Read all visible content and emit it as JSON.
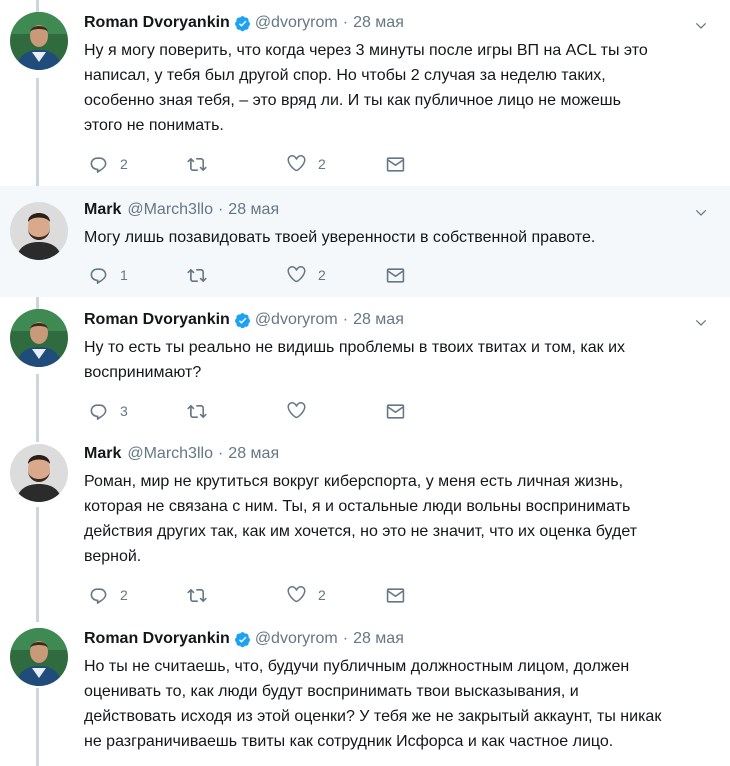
{
  "tweets": [
    {
      "author": "Roman Dvoryankin",
      "handle": "@dvoryrom",
      "separator": "·",
      "date": "28 мая",
      "verified": true,
      "lines": [
        "Ну я могу поверить, что когда через 3 минуты после игры ВП на ACL ты это",
        "написал, у тебя был другой спор. Но чтобы 2 случая за неделю таких,",
        "особенно зная тебя, – это вряд ли. И ты как публичное лицо не можешь",
        "этого не понимать."
      ],
      "replies": "2",
      "retweets": "",
      "likes": "2"
    },
    {
      "author": "Mark",
      "handle": "@March3llo",
      "separator": "·",
      "date": "28 мая",
      "verified": false,
      "lines": [
        "Могу лишь позавидовать твоей уверенности в собственной правоте."
      ],
      "replies": "1",
      "retweets": "",
      "likes": "2"
    },
    {
      "author": "Roman Dvoryankin",
      "handle": "@dvoryrom",
      "separator": "·",
      "date": "28 мая",
      "verified": true,
      "lines": [
        "Ну то есть ты реально не видишь проблемы в твоих твитах и том, как их",
        "воспринимают?"
      ],
      "replies": "3",
      "retweets": "",
      "likes": ""
    },
    {
      "author": "Mark",
      "handle": "@March3llo",
      "separator": "·",
      "date": "28 мая",
      "verified": false,
      "lines": [
        "Роман, мир не крутиться вокруг киберспорта, у меня есть личная жизнь,",
        "которая не связана с ним. Ты, я и остальные люди вольны воспринимать",
        "действия других так, как им хочется, но это не значит, что их оценка будет",
        "верной."
      ],
      "replies": "2",
      "retweets": "",
      "likes": "2"
    },
    {
      "author": "Roman Dvoryankin",
      "handle": "@dvoryrom",
      "separator": "·",
      "date": "28 мая",
      "verified": true,
      "lines": [
        "Но ты не считаешь, что, будучи публичным должностным лицом, должен",
        "оценивать то, как люди будут воспринимать твои высказывания, и",
        "действовать исходя из этой оценки? У тебя же не закрытый аккаунт, ты никак",
        "не разграничиваешь твиты как сотрудник Исфорса и как частное лицо."
      ],
      "replies": "",
      "retweets": "",
      "likes": ""
    }
  ],
  "icons": {
    "reply": "reply-icon",
    "retweet": "retweet-icon",
    "like": "heart-icon",
    "dm": "envelope-icon",
    "caret": "chevron-down-icon",
    "verified": "verified-badge-icon"
  },
  "colors": {
    "verified": "#1da1f2",
    "thread_line": "#ccd6dd",
    "highlight_bg": "#f5f8fa",
    "muted": "#657786"
  }
}
